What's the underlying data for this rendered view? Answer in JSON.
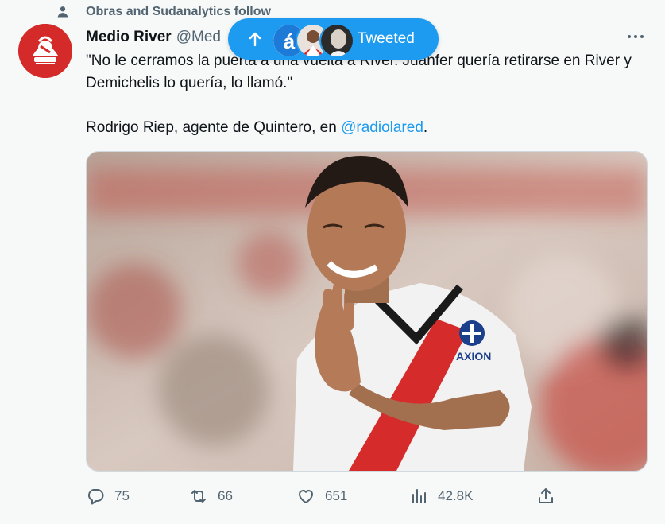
{
  "social_context": {
    "text": "Obras and Sudanalytics follow",
    "icon": "person-icon"
  },
  "author": {
    "name": "Medio River",
    "handle": "@Med"
  },
  "tweet": {
    "line1": "\"No le cerramos la puerta a una vuelta a River. Juanfer quería retirarse en River y Demichelis lo quería, lo llamó.\"",
    "line2_prefix": "Rodrigo Riep, agente de Quintero, en ",
    "mention": "@radiolared",
    "line2_suffix": "."
  },
  "media": {
    "jersey_text": "AXION"
  },
  "actions": {
    "reply": {
      "count": "75",
      "icon": "reply-icon"
    },
    "retweet": {
      "count": "66",
      "icon": "retweet-icon"
    },
    "like": {
      "count": "651",
      "icon": "heart-icon"
    },
    "views": {
      "count": "42.8K",
      "icon": "views-icon"
    },
    "share": {
      "icon": "share-icon"
    }
  },
  "new_tweets_pill": {
    "label": "Tweeted",
    "avatar_letter": "á"
  },
  "colors": {
    "accent": "#1d9bf0",
    "text": "#0f1419",
    "secondary": "#536471",
    "background": "#f7f9f9"
  }
}
